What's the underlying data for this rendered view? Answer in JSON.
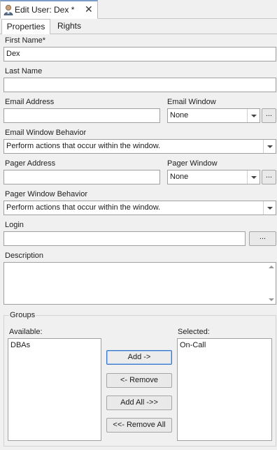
{
  "doc_tab": {
    "title": "Edit User: Dex *",
    "close": "✕"
  },
  "tabs": [
    {
      "label": "Properties"
    },
    {
      "label": "Rights"
    }
  ],
  "form": {
    "first_name": {
      "label": "First Name*",
      "value": "Dex"
    },
    "last_name": {
      "label": "Last Name",
      "value": ""
    },
    "email_address": {
      "label": "Email Address",
      "value": ""
    },
    "email_window": {
      "label": "Email Window",
      "value": "None",
      "browse": "..."
    },
    "email_window_behavior": {
      "label": "Email Window Behavior",
      "value": "Perform actions that occur within the window."
    },
    "pager_address": {
      "label": "Pager Address",
      "value": ""
    },
    "pager_window": {
      "label": "Pager Window",
      "value": "None",
      "browse": "..."
    },
    "pager_window_behavior": {
      "label": "Pager Window Behavior",
      "value": "Perform actions that occur within the window."
    },
    "login": {
      "label": "Login",
      "value": "",
      "browse": "..."
    },
    "description": {
      "label": "Description",
      "value": ""
    }
  },
  "groups": {
    "title": "Groups",
    "available_label": "Available:",
    "selected_label": "Selected:",
    "available": [
      "DBAs"
    ],
    "selected": [
      "On-Call"
    ],
    "buttons": {
      "add": "Add ->",
      "remove": "<- Remove",
      "add_all": "Add All ->>",
      "remove_all": "<<- Remove All"
    }
  }
}
